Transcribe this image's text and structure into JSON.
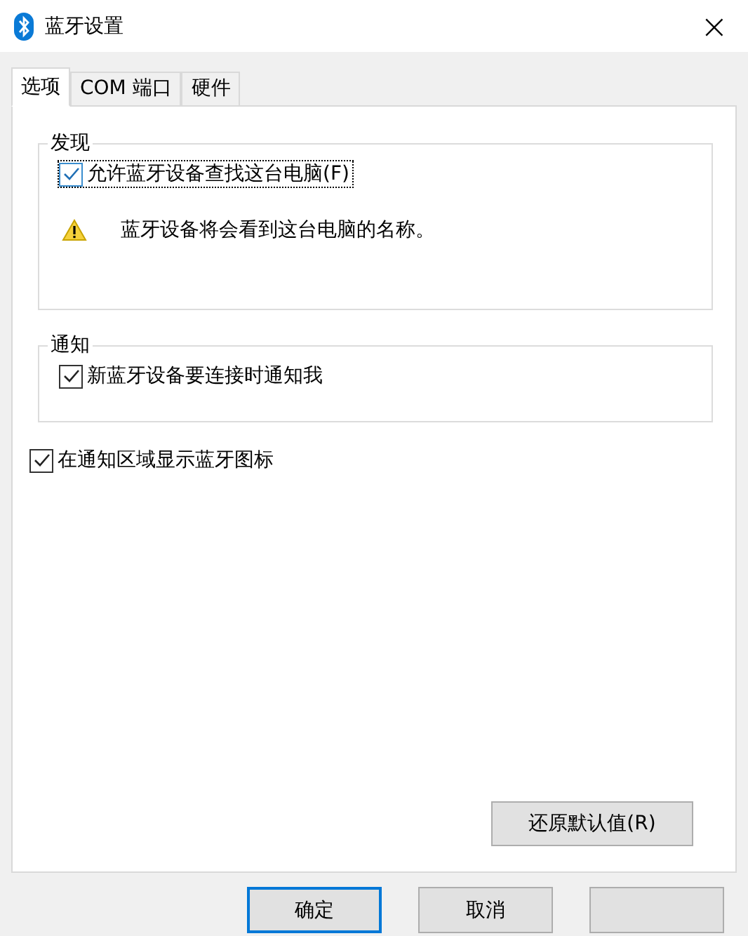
{
  "window": {
    "title": "蓝牙设置",
    "close": "×"
  },
  "tabs": [
    {
      "label": "选项",
      "selected": true
    },
    {
      "label": "COM 端口",
      "selected": false
    },
    {
      "label": "硬件",
      "selected": false
    }
  ],
  "groups": [
    {
      "title": "发现",
      "checkbox": {
        "label": "允许蓝牙设备查找这台电脑(F)",
        "checked": true,
        "focused": true
      },
      "warning": "蓝牙设备将会看到这台电脑的名称。"
    },
    {
      "title": "通知",
      "checkbox": {
        "label": "新蓝牙设备要连接时通知我",
        "checked": true,
        "focused": false
      }
    }
  ],
  "standalone_checkbox": {
    "label": "在通知区域显示蓝牙图标",
    "checked": true
  },
  "restore_button": "还原默认值(R)",
  "buttons": [
    {
      "label": "确定",
      "default": true
    },
    {
      "label": "取消",
      "default": false
    },
    {
      "default": false
    }
  ]
}
